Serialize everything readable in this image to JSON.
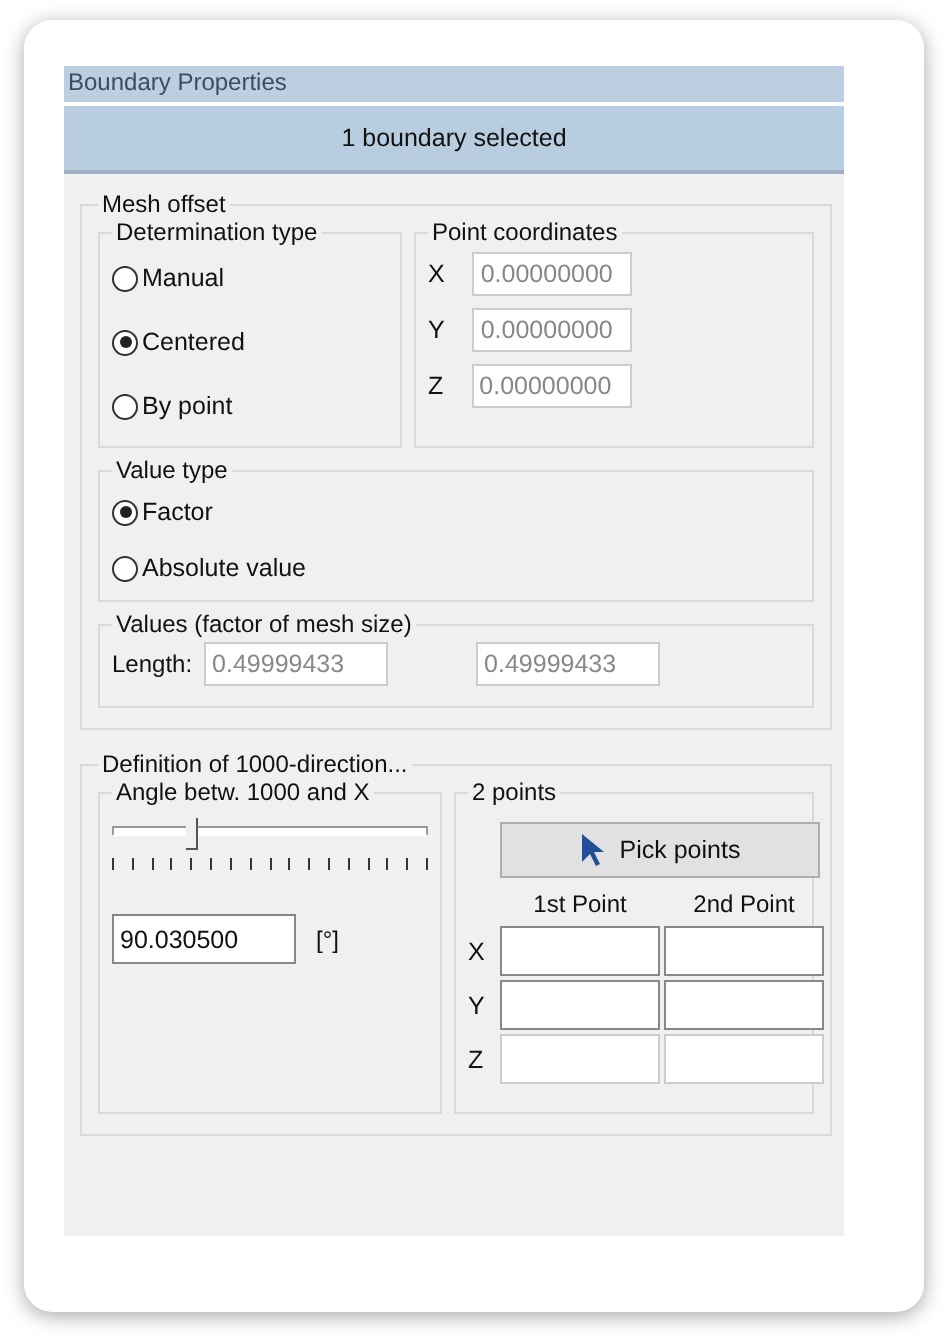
{
  "panel": {
    "title": "Boundary Properties",
    "selection": "1 boundary selected"
  },
  "mesh_offset": {
    "title": "Mesh offset",
    "determination": {
      "title": "Determination type",
      "options": [
        {
          "label": "Manual",
          "selected": false
        },
        {
          "label": "Centered",
          "selected": true
        },
        {
          "label": "By point",
          "selected": false
        }
      ]
    },
    "point_coordinates": {
      "title": "Point coordinates",
      "fields": [
        {
          "label": "X",
          "value": "0.00000000",
          "disabled": true
        },
        {
          "label": "Y",
          "value": "0.00000000",
          "disabled": true
        },
        {
          "label": "Z",
          "value": "0.00000000",
          "disabled": true
        }
      ]
    },
    "value_type": {
      "title": "Value type",
      "options": [
        {
          "label": "Factor",
          "selected": true
        },
        {
          "label": "Absolute value",
          "selected": false
        }
      ]
    },
    "values": {
      "title": "Values (factor of mesh size)",
      "label": "Length:",
      "fields": [
        {
          "value": "0.49999433",
          "disabled": true
        },
        {
          "value": "0.49999433",
          "disabled": true
        }
      ]
    }
  },
  "direction": {
    "title": "Definition of 1000-direction...",
    "angle": {
      "title": "Angle betw. 1000 and X",
      "level": 0.25,
      "value": "90.030500",
      "unit": "[°]"
    },
    "two_points": {
      "title": "2 points",
      "button": "Pick points",
      "columns": [
        "1st Point",
        "2nd Point"
      ],
      "rows": [
        {
          "label": "X",
          "disabled": false
        },
        {
          "label": "Y",
          "disabled": false
        },
        {
          "label": "Z",
          "disabled": true
        }
      ]
    }
  }
}
